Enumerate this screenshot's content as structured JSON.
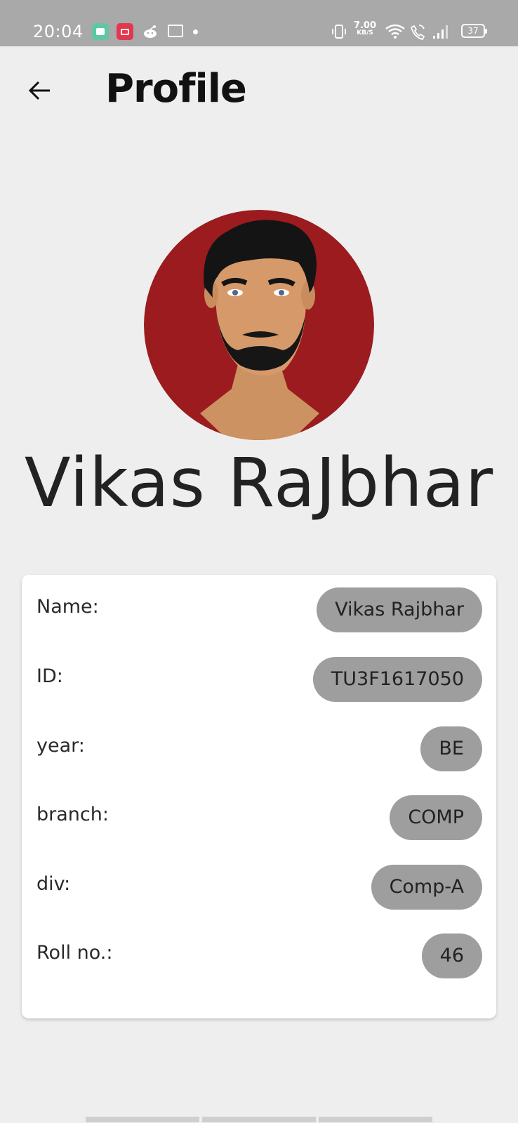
{
  "status_bar": {
    "time": "20:04",
    "net_speed_value": "7.00",
    "net_speed_unit": "KB/S",
    "battery": "37",
    "icons": [
      "chat-icon",
      "video-icon",
      "reddit-icon",
      "mail-icon",
      "dot-icon",
      "vibrate-icon",
      "wifi-icon",
      "wifi-calling-icon",
      "signal-icon",
      "battery-icon"
    ]
  },
  "appbar": {
    "title": "Profile",
    "back_icon": "arrow-left-icon"
  },
  "profile": {
    "display_name": "Vikas RaJbhar",
    "fields": [
      {
        "label": "Name:",
        "value": "Vikas Rajbhar"
      },
      {
        "label": "ID:",
        "value": "TU3F1617050"
      },
      {
        "label": "year:",
        "value": "BE"
      },
      {
        "label": "branch:",
        "value": "COMP"
      },
      {
        "label": "div:",
        "value": "Comp-A"
      },
      {
        "label": "Roll no.:",
        "value": "46"
      }
    ]
  },
  "colors": {
    "avatar_bg": "#9b1b1e",
    "chip_bg": "#9e9e9e",
    "page_bg": "#eeeeee",
    "statusbar_bg": "#a9a9a9"
  }
}
